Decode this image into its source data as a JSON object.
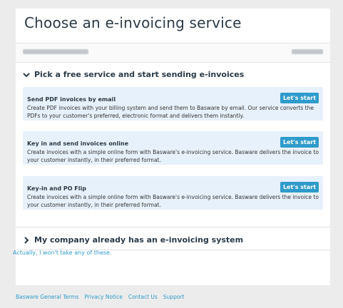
{
  "title": "Choose an e-invoicing service",
  "section_free": {
    "label": "Pick a free service and start sending e-invoices"
  },
  "services": [
    {
      "title": "Send PDF invoices by email",
      "desc": "Create PDF invoices with your billing system and send them to Basware by email. Our service converts the PDFs to your customer's preferred, electronic format and delivers them instantly.",
      "button": "Let's start"
    },
    {
      "title": "Key in and send invoices online",
      "desc": "Create invoices with a simple online form with Basware's e-invoicing service. Basware delivers the invoice to your customer instantly, in their preferred format.",
      "button": "Let's start"
    },
    {
      "title": "Key-in and PO Flip",
      "desc": "Create invoices with a simple online form with Basware's e-invoicing service. Basware delivers the invoice to your customer instantly, in their preferred format.",
      "button": "Let's start"
    }
  ],
  "section_existing": {
    "label": "My company already has an e-invoicing system"
  },
  "decline_link": "Actually, I won't take any of these.",
  "footer": {
    "links": [
      "Basware General Terms",
      "Privacy Notice",
      "Contact Us",
      "Support"
    ]
  },
  "colors": {
    "accent": "#2f9bcb",
    "panel_bg": "#e7f1fb",
    "heading": "#2b3a47"
  }
}
